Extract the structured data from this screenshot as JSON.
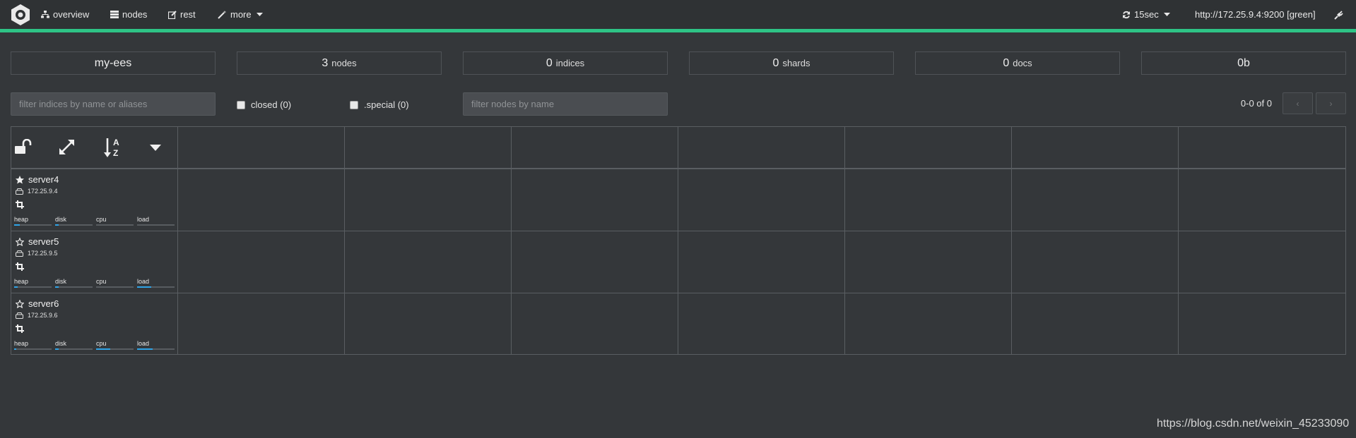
{
  "nav": {
    "overview": "overview",
    "nodes": "nodes",
    "rest": "rest",
    "more": "more",
    "refresh": "15sec",
    "cluster_url": "http://172.25.9.4:9200 [green]"
  },
  "status_color": "#2ec486",
  "stats": {
    "cluster_name": "my-ees",
    "nodes_count": "3",
    "nodes_label": "nodes",
    "indices_count": "0",
    "indices_label": "indices",
    "shards_count": "0",
    "shards_label": "shards",
    "docs_count": "0",
    "docs_label": "docs",
    "size": "0b"
  },
  "filters": {
    "indices_placeholder": "filter indices by name or aliases",
    "closed_label": "closed (0)",
    "special_label": ".special (0)",
    "nodes_placeholder": "filter nodes by name",
    "pager_text": "0-0 of 0"
  },
  "nodes": [
    {
      "name": "server4",
      "ip": "172.25.9.4",
      "master": true,
      "metrics": {
        "heap": "heap",
        "disk": "disk",
        "cpu": "cpu",
        "load": "load"
      },
      "usage": {
        "heap": 0.15,
        "disk": 0.1,
        "cpu": 0.0,
        "load": 0.0
      }
    },
    {
      "name": "server5",
      "ip": "172.25.9.5",
      "master": false,
      "metrics": {
        "heap": "heap",
        "disk": "disk",
        "cpu": "cpu",
        "load": "load"
      },
      "usage": {
        "heap": 0.1,
        "disk": 0.1,
        "cpu": 0.0,
        "load": 0.38
      }
    },
    {
      "name": "server6",
      "ip": "172.25.9.6",
      "master": false,
      "metrics": {
        "heap": "heap",
        "disk": "disk",
        "cpu": "cpu",
        "load": "load"
      },
      "usage": {
        "heap": 0.05,
        "disk": 0.1,
        "cpu": 0.38,
        "load": 0.42
      }
    }
  ],
  "watermark": "https://blog.csdn.net/weixin_45233090"
}
